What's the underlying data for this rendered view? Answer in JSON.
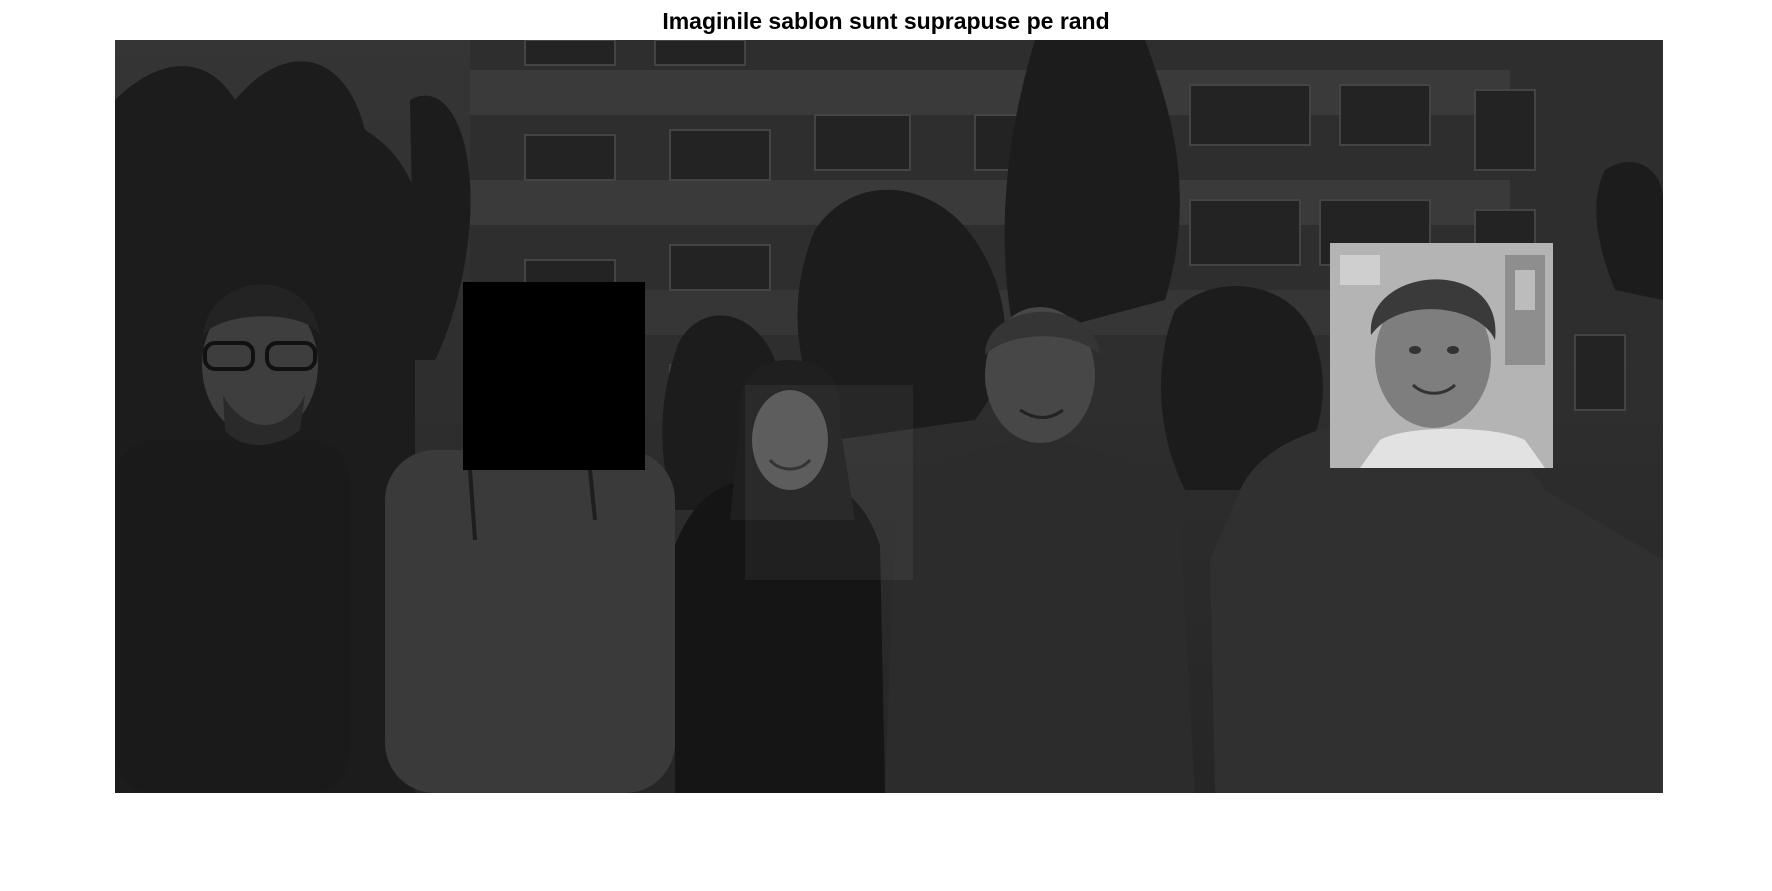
{
  "figure": {
    "title": "Imaginile sablon sunt suprapuse pe rand"
  },
  "colors": {
    "background": "#ffffff",
    "scene_dim": "#2a2a2a",
    "masked_patch": "#000000",
    "highlighted_patch": "#b4b4b4"
  },
  "icons": [
    "group-photo-image",
    "person-silhouette",
    "template-overlay-patch"
  ]
}
